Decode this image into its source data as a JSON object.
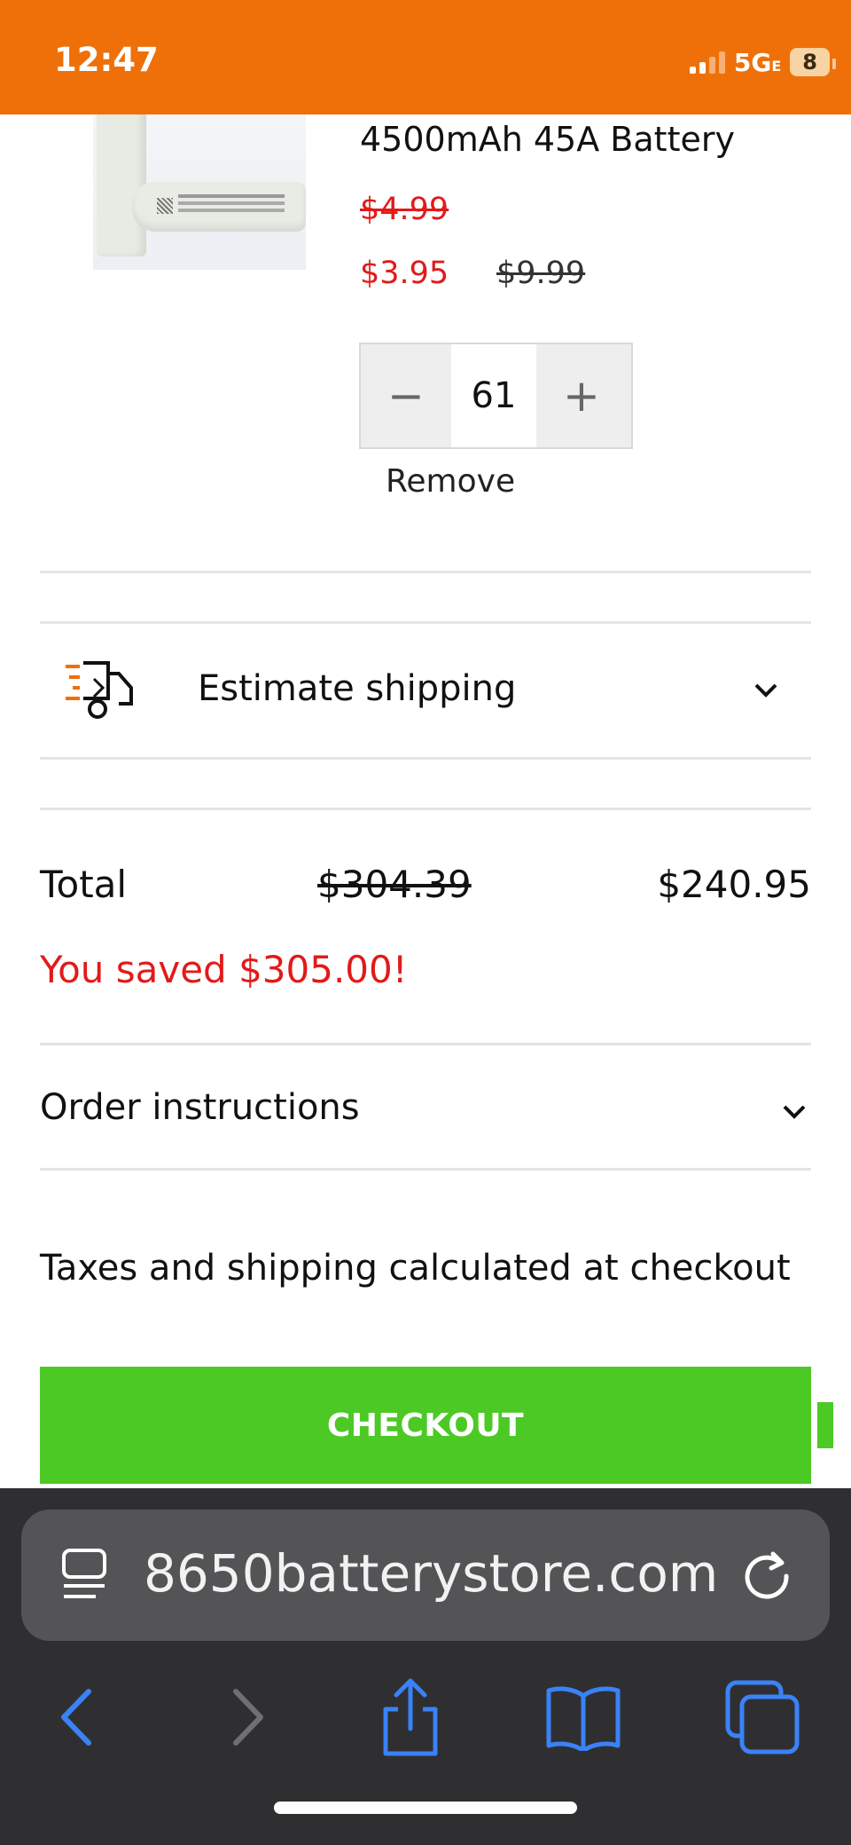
{
  "status_bar": {
    "time": "12:47",
    "network": "5G",
    "network_suffix": "E",
    "battery": "8",
    "background": "#ef7009"
  },
  "cart_item": {
    "title": "4500mAh 45A Battery",
    "old_price": "$4.99",
    "sale_price": "$3.95",
    "compare_price": "$9.99",
    "quantity": "61",
    "decrement_label": "−",
    "increment_label": "+",
    "remove_label": "Remove"
  },
  "shipping": {
    "label": "Estimate shipping",
    "icon": "truck-icon"
  },
  "totals": {
    "label": "Total",
    "original": "$304.39",
    "final": "$240.95",
    "saved_message": "You saved $305.00!"
  },
  "order_instructions": {
    "label": "Order instructions"
  },
  "taxes_note": "Taxes and shipping calculated at checkout",
  "checkout": {
    "label": "CHECKOUT",
    "color": "#4cc925"
  },
  "browser": {
    "url": "8650batterystore.com",
    "icons": [
      "reader-icon",
      "reload-icon",
      "back-icon",
      "forward-icon",
      "share-icon",
      "bookmarks-icon",
      "tabs-icon"
    ],
    "accent": "#3a82f7"
  }
}
